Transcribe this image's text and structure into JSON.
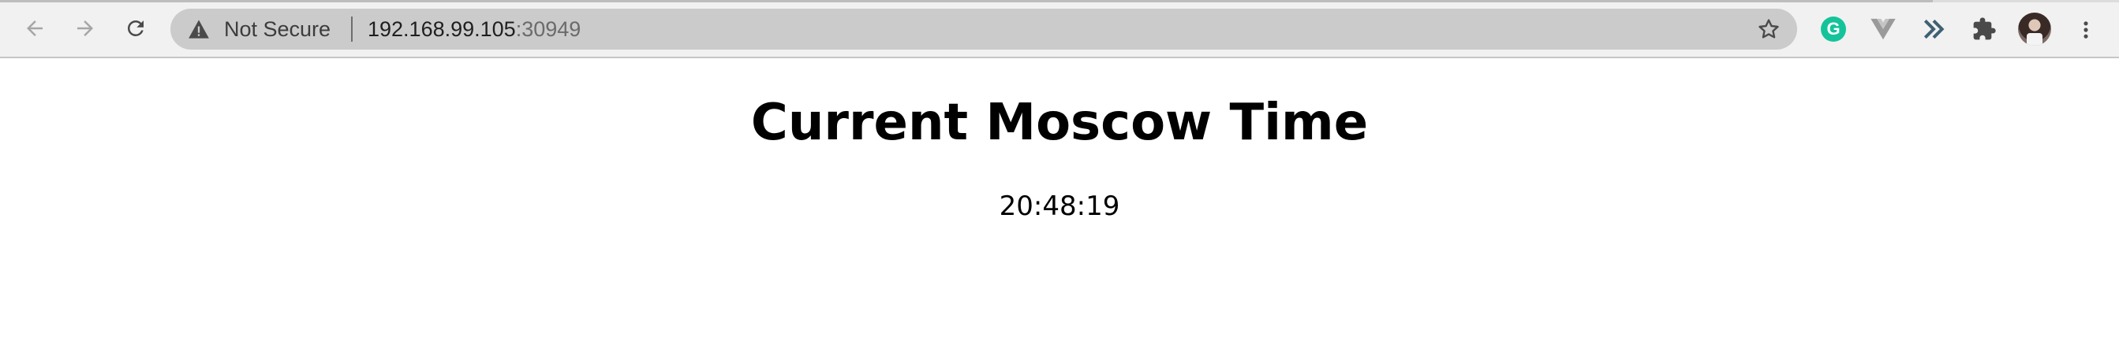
{
  "browser": {
    "nav": {
      "back_icon": "arrow-left-icon",
      "forward_icon": "arrow-right-icon",
      "reload_icon": "reload-icon"
    },
    "address_bar": {
      "security_icon": "warning-triangle-icon",
      "security_label": "Not Secure",
      "url_host": "192.168.99.105",
      "url_port": ":30949",
      "bookmark_icon": "star-icon"
    },
    "extensions": [
      {
        "name": "grammarly-extension",
        "icon": "grammarly-icon",
        "letter": "G",
        "color": "#15c39a"
      },
      {
        "name": "vue-devtools-extension",
        "icon": "vue-icon"
      },
      {
        "name": "double-chevron-extension",
        "icon": "double-chevron-icon"
      },
      {
        "name": "extensions-menu",
        "icon": "puzzle-icon"
      }
    ],
    "profile_icon": "avatar",
    "menu_icon": "kebab-menu-icon"
  },
  "page": {
    "title": "Current Moscow Time",
    "time": "20:48:19"
  }
}
